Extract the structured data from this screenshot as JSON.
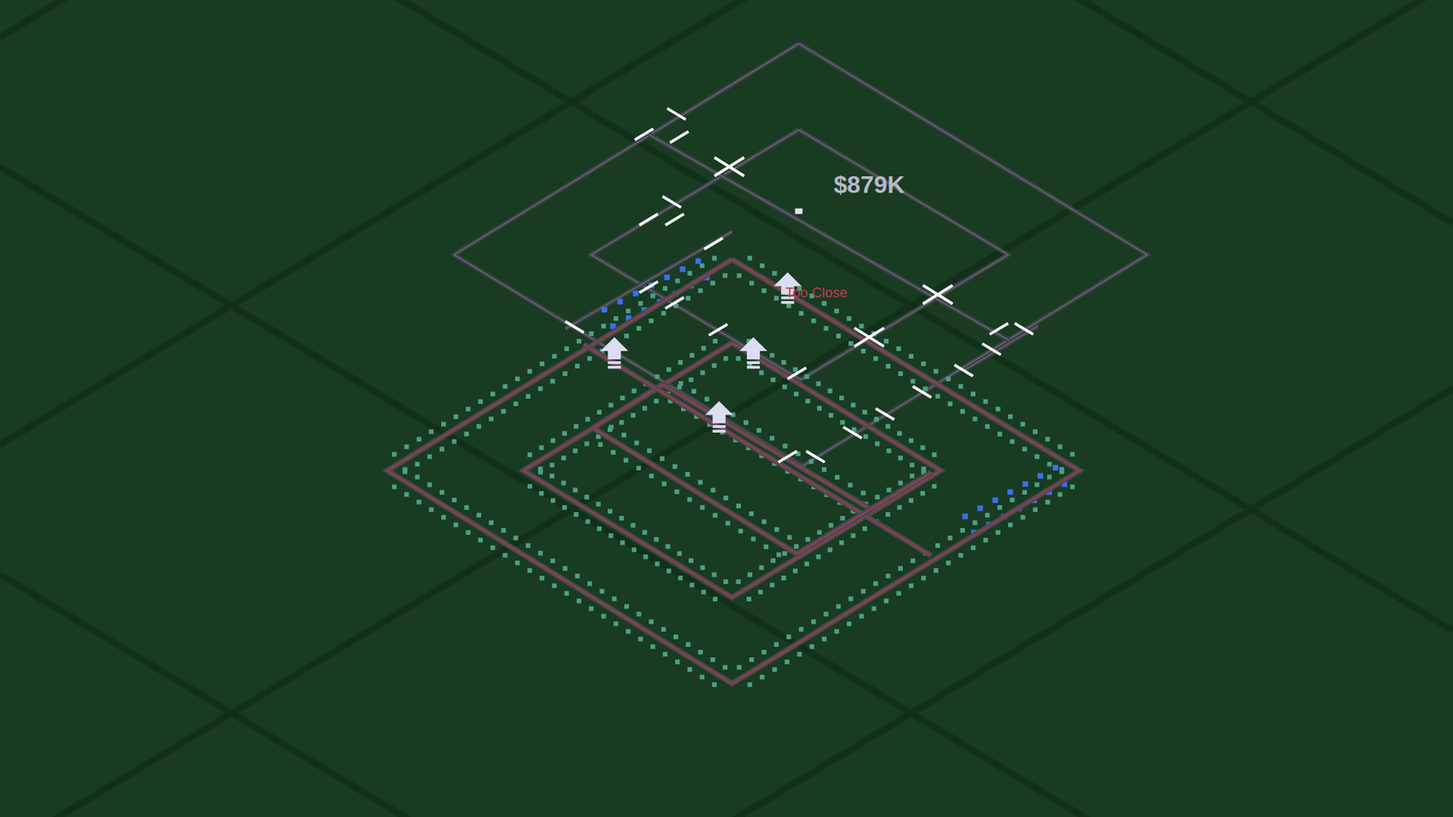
{
  "hud": {
    "money": "$879K",
    "warning": "Too Close"
  }
}
